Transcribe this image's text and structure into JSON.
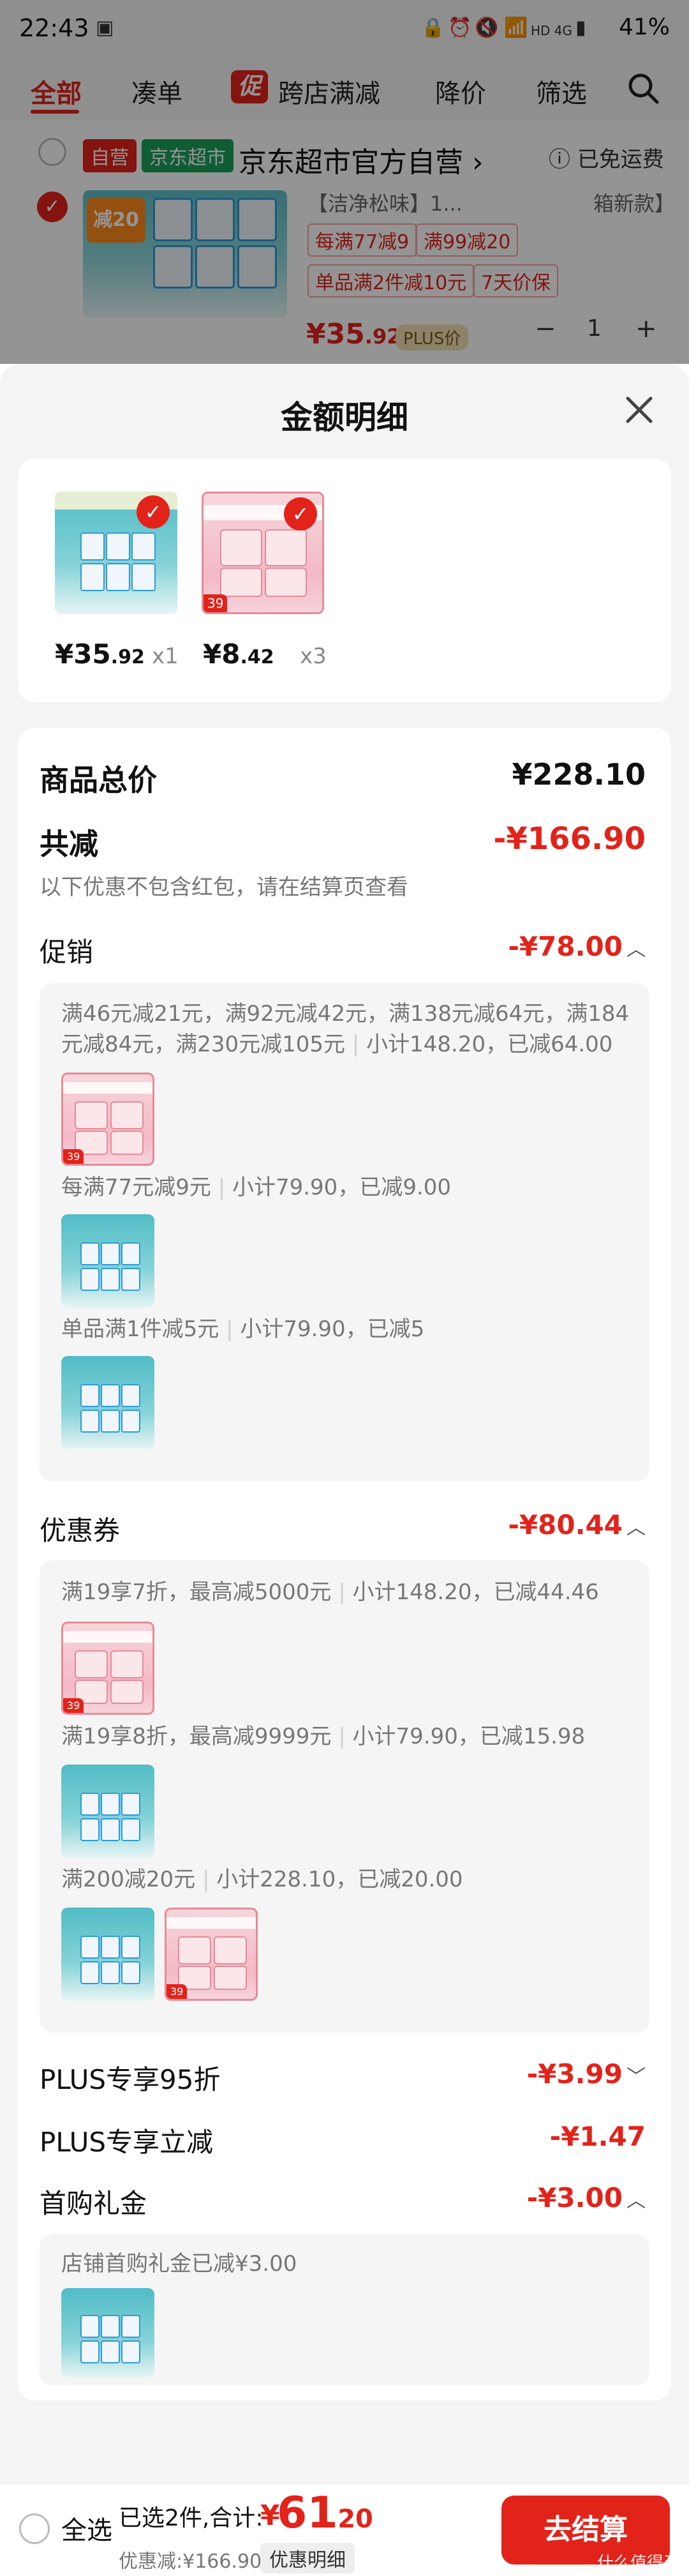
{
  "statusbar": {
    "time": "22:43",
    "network": "HD 4G",
    "battery": "41%"
  },
  "topnav": {
    "tabs": [
      "全部",
      "凑单",
      "跨店满减",
      "降价",
      "筛选"
    ],
    "promo_badge": "促"
  },
  "store": {
    "tag_self": "自营",
    "tag_market": "京东超市",
    "name": "京东超市官方自营",
    "arrow": "›",
    "free_shipping": "已免运费"
  },
  "product_bg": {
    "title_snippet": "【洁净松味】1...",
    "right_snippet": "箱新款】",
    "img_burst": "减20",
    "tags": [
      "每满77减9",
      "满99减20",
      "单品满2件减10元",
      "7天价保"
    ],
    "price_int": "¥35",
    "price_dec": ".92",
    "plus_tag": "PLUS价",
    "qty": "1",
    "minus": "−",
    "plus": "+"
  },
  "sheet": {
    "title": "金额明细",
    "items": [
      {
        "price_int": "¥35",
        "price_dec": ".92",
        "qty": "x1"
      },
      {
        "price_int": "¥8",
        "price_dec": ".42",
        "qty": "x3"
      }
    ],
    "total": {
      "label": "商品总价",
      "value": "¥228.10"
    },
    "reduce": {
      "label": "共减",
      "value": "-¥166.90",
      "note": "以下优惠不包含红包，请在结算页查看"
    },
    "promo": {
      "label": "促销",
      "value": "-¥78.00",
      "detail1_a": "满46元减21元，满92元减42元，满138元减64元，满184",
      "detail1_b": "元减84元，满230元减105元",
      "detail1_c": "小计148.20，已减64.00",
      "detail2_a": "每满77元减9元",
      "detail2_b": "小计79.90，已减9.00",
      "detail3_a": "单品满1件减5元",
      "detail3_b": "小计79.90，已减5"
    },
    "coupon": {
      "label": "优惠券",
      "value": "-¥80.44",
      "detail1_a": "满19享7折，最高减5000元",
      "detail1_b": "小计148.20，已减44.46",
      "detail2_a": "满19享8折，最高减9999元",
      "detail2_b": "小计79.90，已减15.98",
      "detail3_a": "满200减20元",
      "detail3_b": "小计228.10，已减20.00"
    },
    "plus95": {
      "label": "PLUS专享95折",
      "value": "-¥3.99"
    },
    "plusreduce": {
      "label": "PLUS专享立减",
      "value": "-¥1.47"
    },
    "firstbuy": {
      "label": "首购礼金",
      "value": "-¥3.00",
      "detail": "店铺首购礼金已减¥3.00"
    },
    "thumb_badge": "39"
  },
  "bottombar": {
    "select_all": "全选",
    "summary": "已选2件,合计:",
    "currency": "¥",
    "amount_int": "61",
    "amount_dec": ".20",
    "discount": "优惠减:¥166.90",
    "detail_btn": "优惠明细",
    "checkout": "去结算",
    "watermark": "什么值得买"
  },
  "colors": {
    "accent": "#e2231a",
    "green": "#1aa05a"
  }
}
